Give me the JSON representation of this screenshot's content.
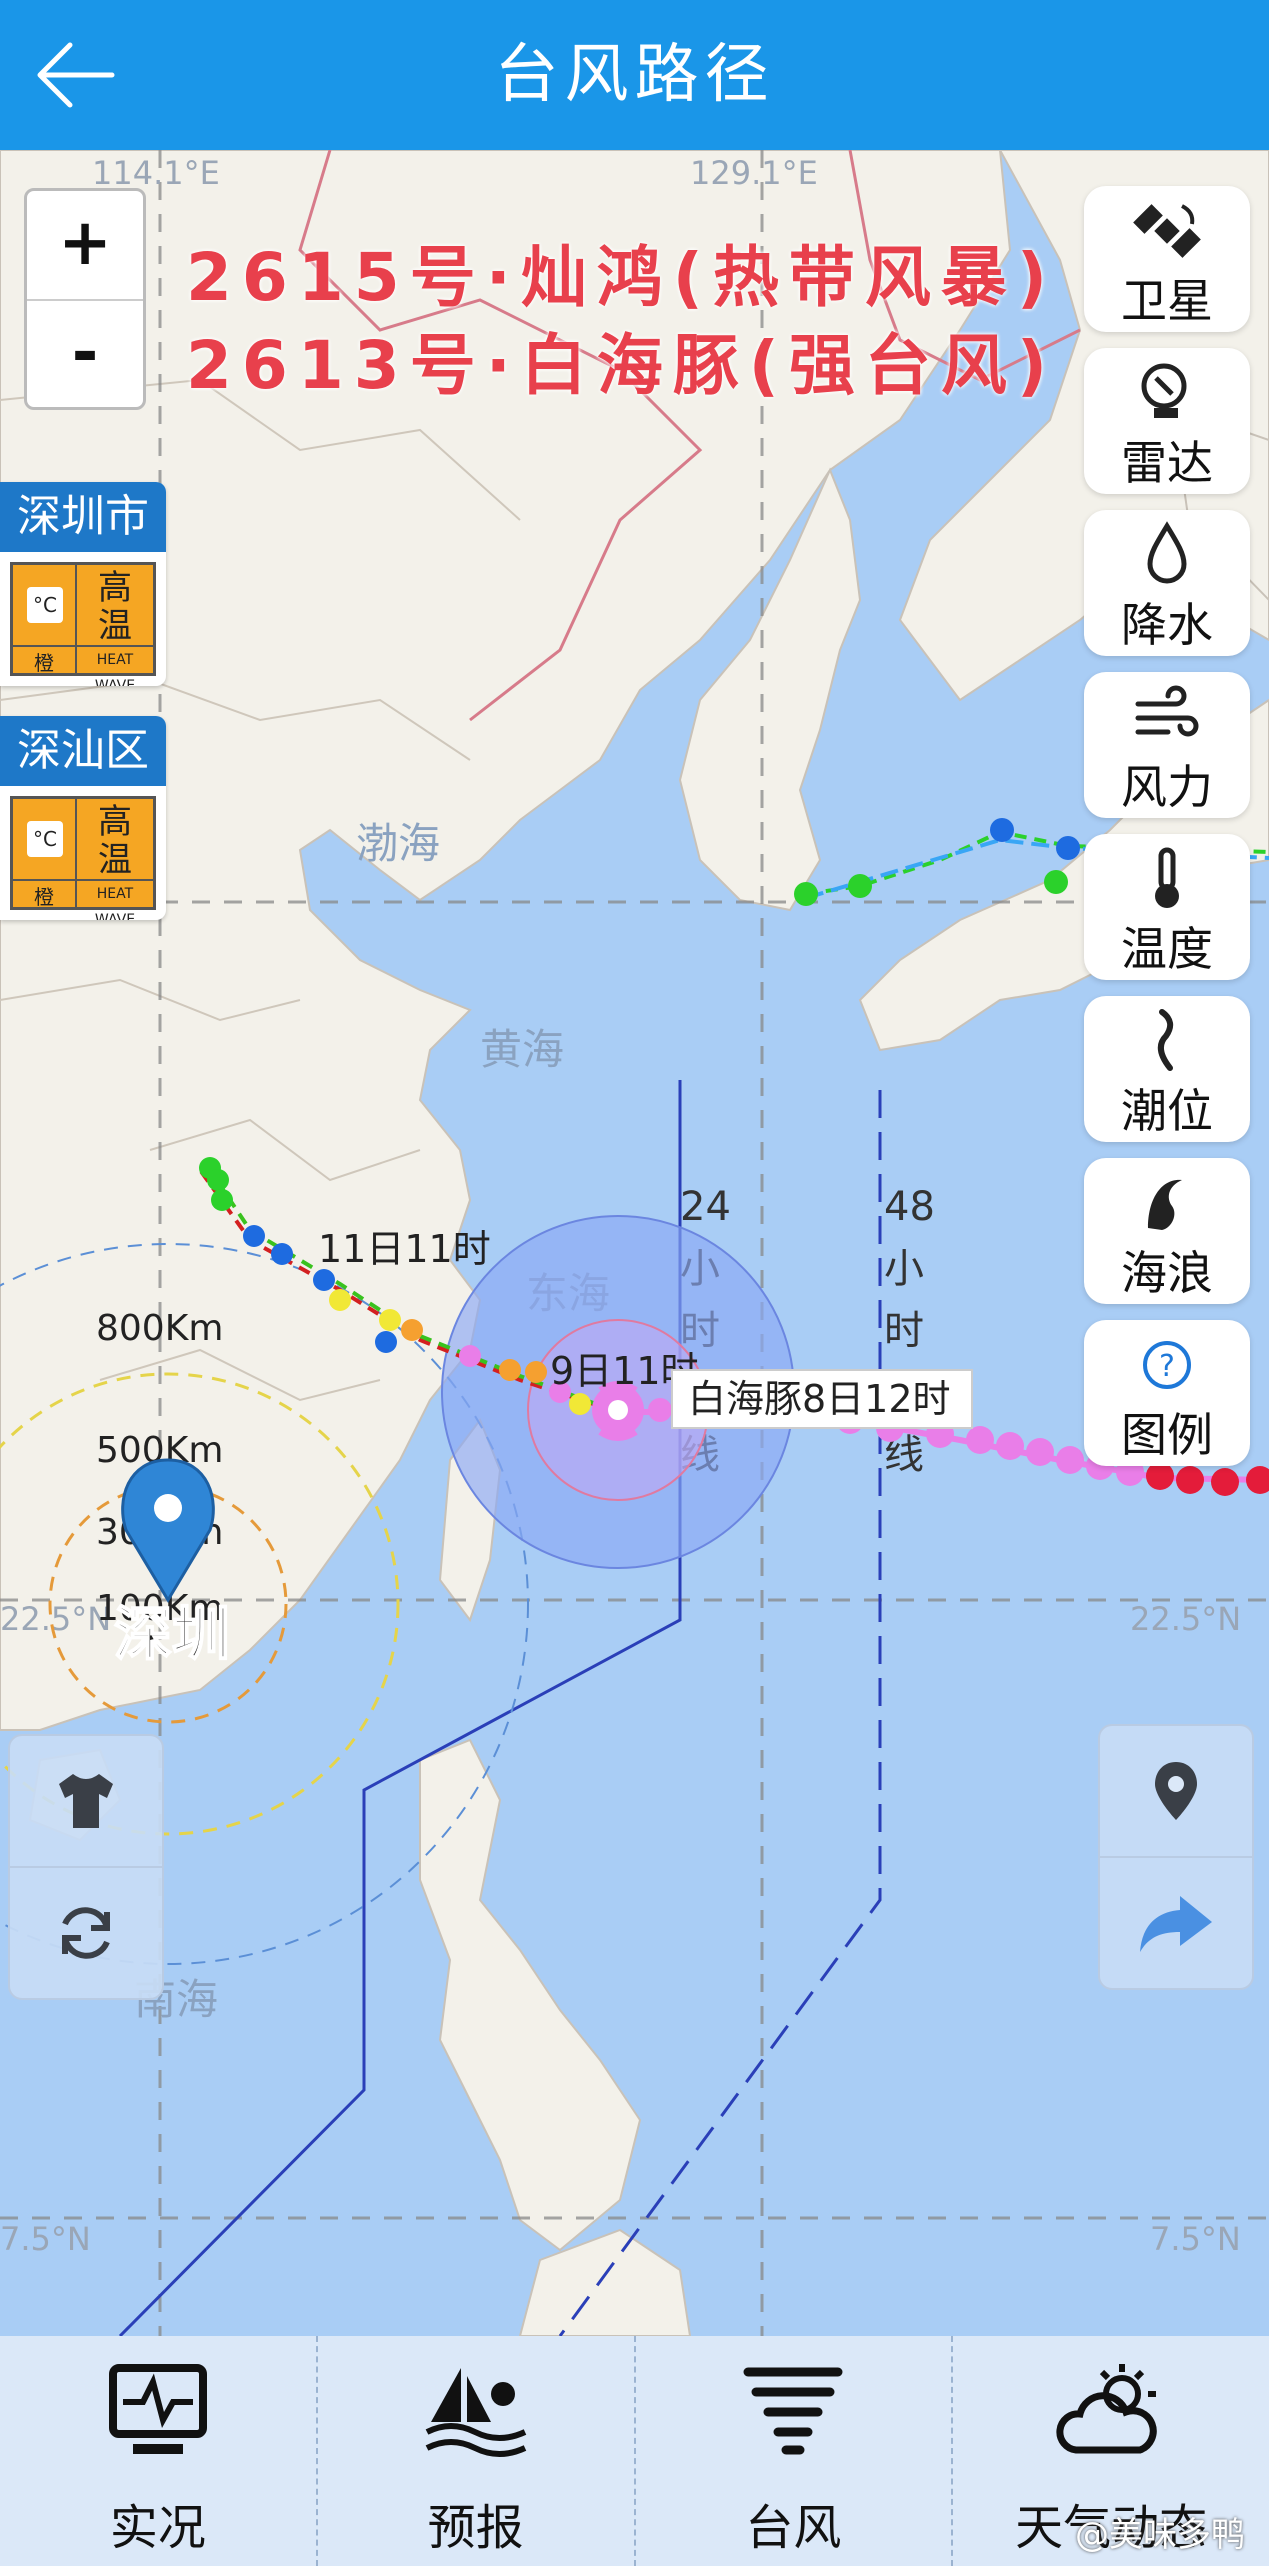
{
  "header": {
    "title": "台风路径",
    "back_icon": "arrow-left-icon"
  },
  "zoom": {
    "plus": "+",
    "minus": "-"
  },
  "typhoons": [
    {
      "label": "2615号·灿鸿(热带风暴)"
    },
    {
      "label": "2613号·白海豚(强台风)"
    }
  ],
  "alerts": [
    {
      "region": "深圳市",
      "signal": "高温",
      "level": "橙",
      "unit": "°C",
      "tag": "HEAT WAVE"
    },
    {
      "region": "深汕区",
      "signal": "高温",
      "level": "橙",
      "unit": "°C",
      "tag": "HEAT WAVE"
    }
  ],
  "layers": [
    {
      "label": "卫星",
      "icon": "satellite-icon"
    },
    {
      "label": "雷达",
      "icon": "radar-icon"
    },
    {
      "label": "降水",
      "icon": "raindrop-icon"
    },
    {
      "label": "风力",
      "icon": "wind-icon"
    },
    {
      "label": "温度",
      "icon": "thermometer-icon"
    },
    {
      "label": "潮位",
      "icon": "tide-icon"
    },
    {
      "label": "海浪",
      "icon": "wave-icon"
    },
    {
      "label": "图例",
      "icon": "help-icon"
    }
  ],
  "map": {
    "lon_labels": [
      "114.1°E",
      "129.1°E"
    ],
    "lat_labels": [
      "22.5°N",
      "22.5°N",
      "7.5°N",
      "7.5°N"
    ],
    "seas": [
      "渤海",
      "黄海",
      "东海",
      "南海"
    ],
    "warn_24": "24小时戒线",
    "warn_48": "48小时戒线",
    "track_label_1": "11日11时",
    "track_label_2": "9日11时",
    "current_label": "白海豚8日12时",
    "city": "深圳",
    "ranges": [
      "800Km",
      "500Km",
      "300Km",
      "100Km"
    ]
  },
  "side_left": [
    "tshirt-icon",
    "refresh-icon"
  ],
  "side_right": [
    "location-icon",
    "share-icon"
  ],
  "nav": [
    {
      "label": "实况",
      "icon": "monitor-icon"
    },
    {
      "label": "预报",
      "icon": "sailboat-icon"
    },
    {
      "label": "台风",
      "icon": "typhoon-icon"
    },
    {
      "label": "天气动态",
      "icon": "cloud-sun-icon"
    }
  ],
  "watermark": "@美味多鸭",
  "colors": {
    "header": "#1a96e8",
    "title_red": "#e8404c",
    "sea": "#a9cdf5",
    "land": "#f3f1ea",
    "track_pink": "#e97ee8"
  }
}
